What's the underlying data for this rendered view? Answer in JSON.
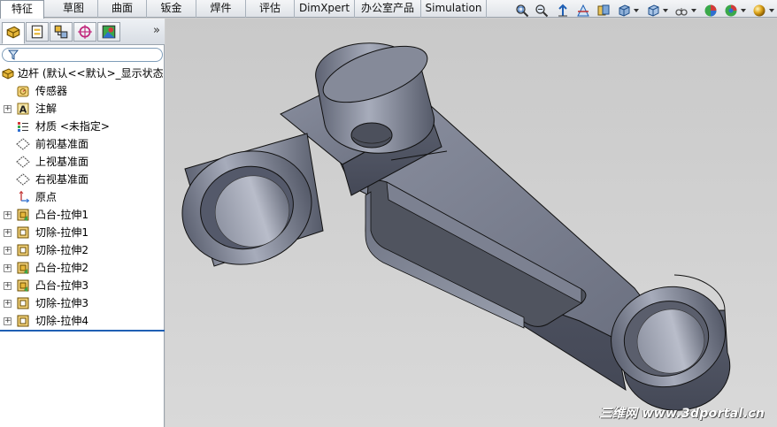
{
  "tabs": [
    {
      "label": "特征",
      "active": true
    },
    {
      "label": "草图"
    },
    {
      "label": "曲面"
    },
    {
      "label": "钣金"
    },
    {
      "label": "焊件"
    },
    {
      "label": "评估"
    },
    {
      "label": "DimXpert"
    },
    {
      "label": "办公室产品"
    },
    {
      "label": "Simulation"
    }
  ],
  "toolbar": {
    "icons": [
      "zoom-to-fit-icon",
      "zoom-area-icon",
      "previous-view-icon",
      "section-view-icon",
      "view-orientation-icon",
      "display-style-icon",
      "hide-show-items-icon",
      "edit-appearance-icon",
      "apply-scene-icon",
      "view-settings-icon"
    ]
  },
  "panel": {
    "tabs": [
      "featuremanager-tab",
      "propertymanager-tab",
      "configurationmanager-tab",
      "dimxpert-tab",
      "display-manager-tab"
    ],
    "collapse_glyph": "»"
  },
  "tree": {
    "root": "边杆  (默认<<默认>_显示状态",
    "items": [
      {
        "label": "传感器",
        "icon": "sensor-icon",
        "expandable": false
      },
      {
        "label": "注解",
        "icon": "annotations-icon",
        "expandable": true
      },
      {
        "label": "材质 <未指定>",
        "icon": "material-icon",
        "expandable": false
      },
      {
        "label": "前视基准面",
        "icon": "plane-icon",
        "expandable": false
      },
      {
        "label": "上视基准面",
        "icon": "plane-icon",
        "expandable": false
      },
      {
        "label": "右视基准面",
        "icon": "plane-icon",
        "expandable": false
      },
      {
        "label": "原点",
        "icon": "origin-icon",
        "expandable": false
      },
      {
        "label": "凸台-拉伸1",
        "icon": "boss-extrude-icon",
        "expandable": true
      },
      {
        "label": "切除-拉伸1",
        "icon": "cut-extrude-icon",
        "expandable": true
      },
      {
        "label": "切除-拉伸2",
        "icon": "cut-extrude-icon",
        "expandable": true
      },
      {
        "label": "凸台-拉伸2",
        "icon": "boss-extrude-icon",
        "expandable": true
      },
      {
        "label": "凸台-拉伸3",
        "icon": "boss-extrude-icon",
        "expandable": true
      },
      {
        "label": "切除-拉伸3",
        "icon": "cut-extrude-icon",
        "expandable": true
      },
      {
        "label": "切除-拉伸4",
        "icon": "cut-extrude-icon",
        "expandable": true
      }
    ]
  },
  "watermark": "三维网 www.3dportal.cn",
  "colors": {
    "part_body": "#6f7484",
    "part_light": "#9ea3b2",
    "part_dark": "#3f4350",
    "viewport_bg": "#d0d0d0",
    "accent": "#1f5fb4"
  }
}
